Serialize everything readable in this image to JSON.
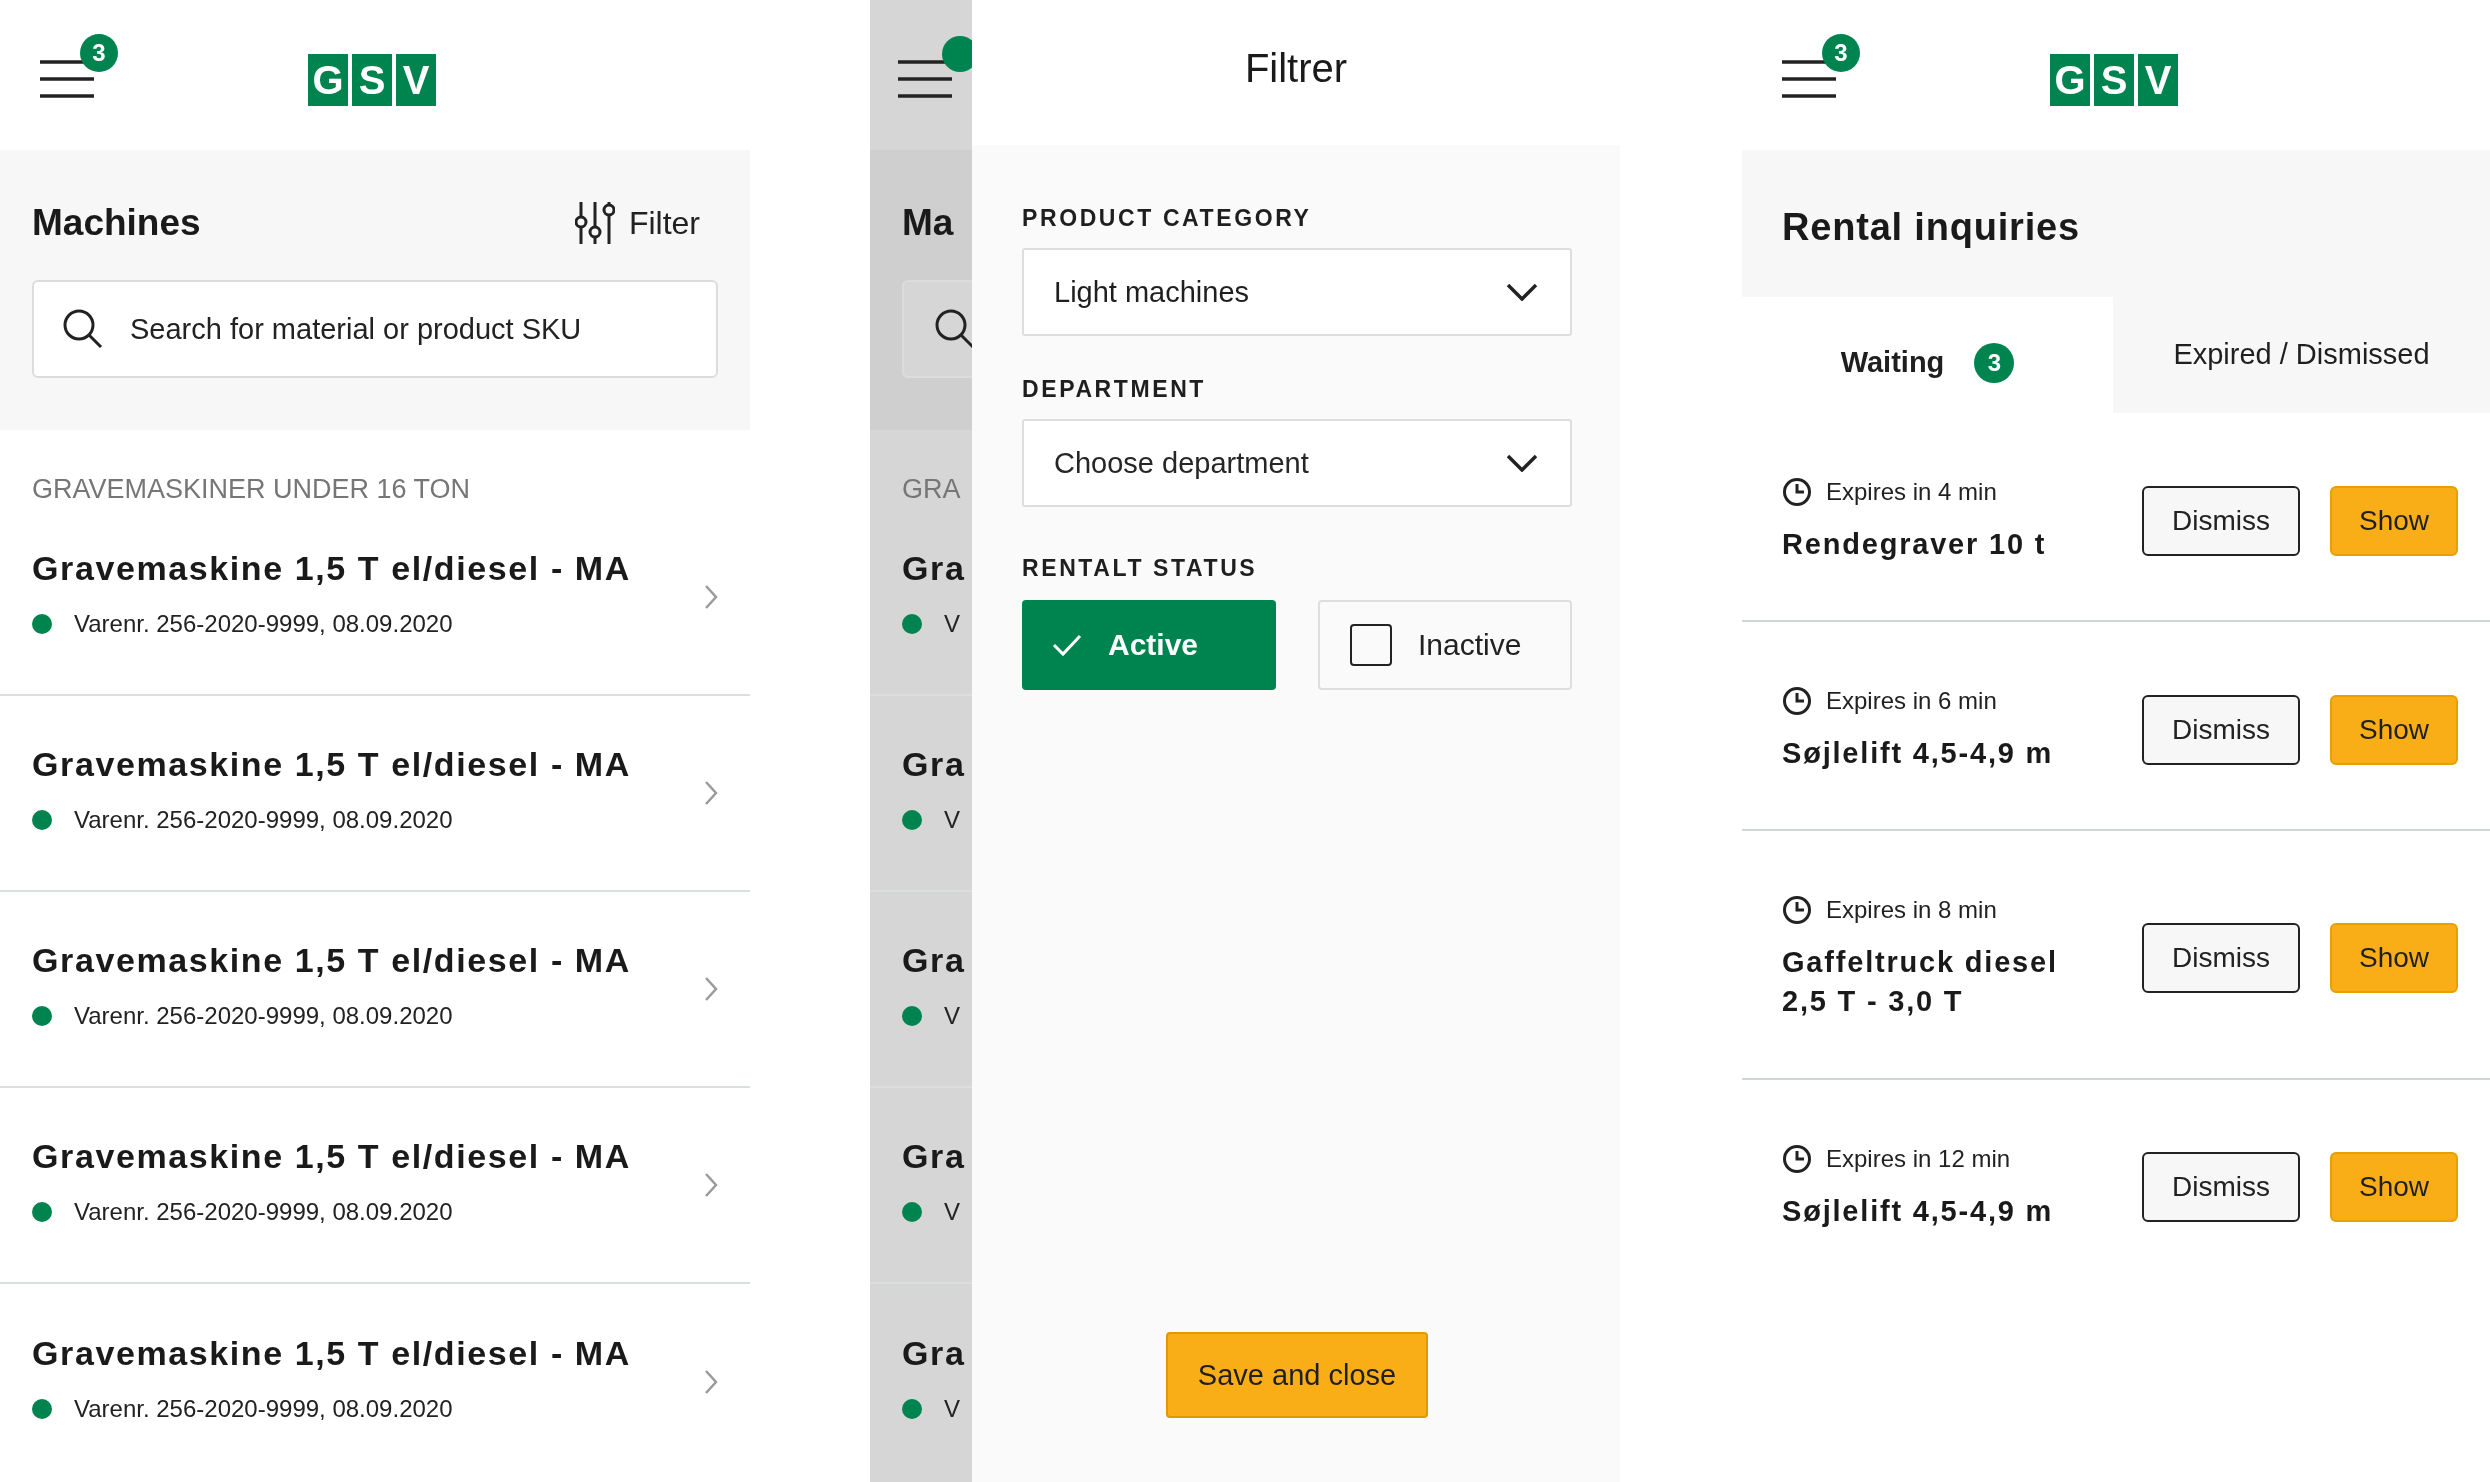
{
  "machines_screen": {
    "header": {
      "badge": "3",
      "logo": [
        "G",
        "S",
        "V"
      ]
    },
    "title": "Machines",
    "filter_button": "Filter",
    "search": {
      "placeholder": "Search for material or product SKU"
    },
    "section_heading": "GRAVEMASKINER UNDER 16 TON",
    "items": [
      {
        "name": "Gravemaskine 1,5 T el/diesel - MA",
        "sku": "Varenr. 256-2020-9999, 08.09.2020",
        "color": "#00844f"
      },
      {
        "name": "Gravemaskine 1,5 T el/diesel - MA",
        "sku": "Varenr. 256-2020-9999, 08.09.2020",
        "color": "#00844f"
      },
      {
        "name": "Gravemaskine 1,5 T el/diesel - MA",
        "sku": "Varenr. 256-2020-9999, 08.09.2020",
        "color": "#00844f"
      },
      {
        "name": "Gravemaskine 1,5 T el/diesel - MA",
        "sku": "Varenr. 256-2020-9999, 08.09.2020",
        "color": "#00844f"
      },
      {
        "name": "Gravemaskine 1,5 T el/diesel - MA",
        "sku": "Varenr. 256-2020-9999, 08.09.2020",
        "color": "#00844f"
      }
    ]
  },
  "filter_screen": {
    "background": {
      "title": "Ma",
      "section_heading": "GRA",
      "items": [
        {
          "name": "Gra",
          "sku": "V",
          "color": "#00844f"
        },
        {
          "name": "Gra",
          "sku": "V",
          "color": "#00844f"
        },
        {
          "name": "Gra",
          "sku": "V",
          "color": "#00844f"
        },
        {
          "name": "Gra",
          "sku": "V",
          "color": "#00844f"
        },
        {
          "name": "Gra",
          "sku": "V",
          "color": "#00844f"
        }
      ]
    },
    "drawer": {
      "title": "Filtrer",
      "fields": [
        {
          "label": "PRODUCT CATEGORY",
          "value": "Light machines"
        },
        {
          "label": "DEPARTMENT",
          "placeholder": "Choose department"
        }
      ],
      "status": {
        "label": "RENTALT STATUS",
        "options": [
          {
            "label": "Active",
            "selected": true
          },
          {
            "label": "Inactive",
            "selected": false
          }
        ]
      },
      "save_button": "Save and close"
    }
  },
  "inquiries_screen": {
    "header": {
      "badge": "3",
      "logo": [
        "G",
        "S",
        "V"
      ]
    },
    "title": "Rental inquiries",
    "tabs": [
      {
        "label": "Waiting",
        "count": "3",
        "selected": true
      },
      {
        "label": "Expired / Dismissed",
        "selected": false
      }
    ],
    "inquiries": [
      {
        "expires": "Expires in 4 min",
        "name": "Rendegraver 10 t",
        "dismiss": "Dismiss",
        "show": "Show"
      },
      {
        "expires": "Expires in 6 min",
        "name": "Søjlelift 4,5-4,9 m",
        "dismiss": "Dismiss",
        "show": "Show"
      },
      {
        "expires": "Expires in 8 min",
        "name": "Gaffeltruck diesel 2,5 T - 3,0 T",
        "dismiss": "Dismiss",
        "show": "Show"
      },
      {
        "expires": "Expires in 12 min",
        "name": "Søjlelift 4,5-4,9 m",
        "dismiss": "Dismiss",
        "show": "Show"
      }
    ]
  }
}
